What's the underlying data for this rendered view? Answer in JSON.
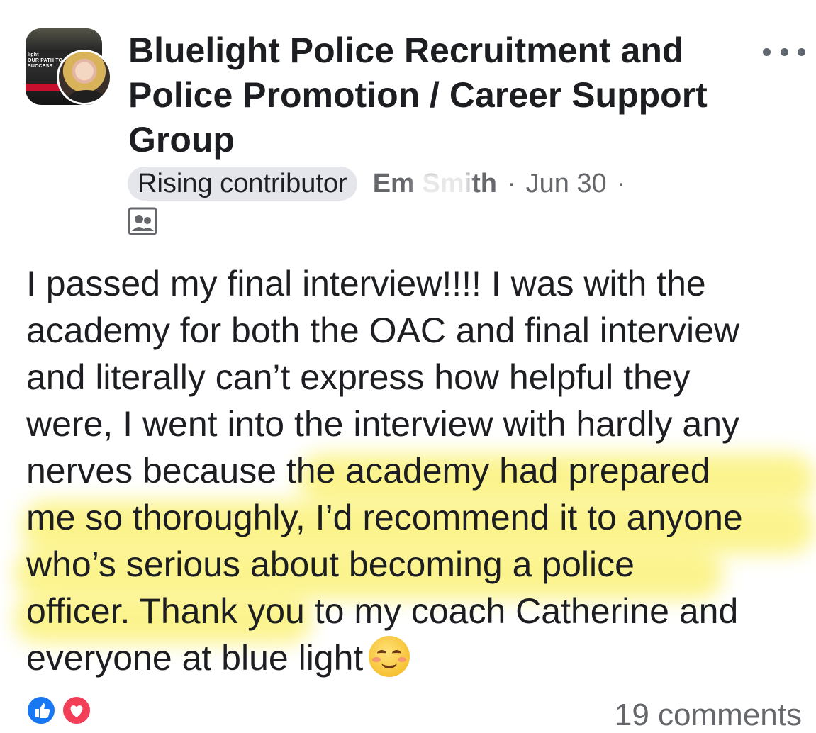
{
  "post": {
    "group_avatar_text": "light\nOUR PATH TO\nSUCCESS",
    "group_name": "Bluelight Police Recruitment and Police Promotion / Career Support Group",
    "badge": "Rising contributor",
    "author": "Em   Smith",
    "separator": "·",
    "date": "Jun 30",
    "body_lines": [
      "I passed my final interview!!!! I was with the",
      "academy for both the OAC and final interview",
      "and literally can’t express how helpful they",
      "were, I went into the interview with hardly any",
      "nerves because the academy had prepared",
      "me so thoroughly, I’d recommend it to anyone",
      "who’s serious about becoming a police",
      "officer. Thank you to my coach Catherine and",
      "everyone at blue light"
    ],
    "emoji": "smiling-face-with-blush",
    "comments": "19 comments"
  },
  "icons": {
    "more": "more-options-icon",
    "audience": "group-audience-icon",
    "like": "like-reaction-icon",
    "love": "love-reaction-icon"
  },
  "colors": {
    "text": "#1c1e21",
    "secondary": "#65676b",
    "badge_bg": "#e4e6eb",
    "highlight": "#fbf27a",
    "like": "#1877f2",
    "love": "#f33e58"
  }
}
